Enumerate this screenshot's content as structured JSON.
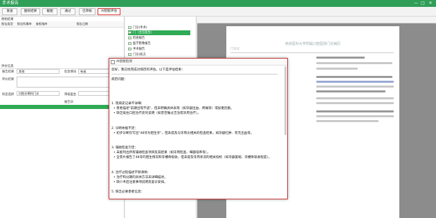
{
  "app": {
    "title": "手术报告",
    "win_min": "—",
    "win_max": "□",
    "win_close": "✕"
  },
  "toolbar": {
    "buttons": [
      "发送",
      "图标结果",
      "截图",
      "通过",
      "已审核",
      "AI智能评估"
    ],
    "active_index": 5
  },
  "left": {
    "section1": "原始结果",
    "grid_headers": [
      "报告类型",
      "报告所属库",
      "查报指库",
      "",
      "报告日期"
    ],
    "section2": "评价信息",
    "row1": {
      "label_a": "报告结果",
      "value_a": "其他",
      "label_b": "危急情况",
      "value_b": "有或"
    },
    "row2": {
      "label_a": "评价结果"
    },
    "row3": {
      "label_a": "科室选择",
      "value_a": "口腔诊断科门诊",
      "label_b": "审核医生"
    },
    "row4": {
      "label_b": "报告日"
    }
  },
  "tree": {
    "items": [
      "门诊(手术)",
      "门（主任医生）",
      "检查报告",
      "医学影像报告",
      "手术报告",
      "门诊(处方"
    ],
    "selected_index": 1
  },
  "document": {
    "title_line": "南京医科大学附属口腔医院门诊病历",
    "subtitle_line": "门诊号"
  },
  "dialog": {
    "title": "AI智能检测",
    "lines": [
      {
        "t": "您好，我已经完成对病历的评估。以下是评估结果：",
        "cls": ""
      },
      {
        "t": "病历问题：",
        "cls": ""
      },
      {
        "t": "1. 现病史记录不详细：",
        "cls": ""
      },
      {
        "t": "• 患者描述\"前期出现不适\"，但未明确具体表现（如牙龈出血、疼痛等）或加重因素。",
        "cls": "sub"
      },
      {
        "t": "• 缺乏既往口腔治疗史的说明（如曾否做过洁治或牙周治疗）。",
        "cls": "sub"
      },
      {
        "t": "2. 诊断依据不足：",
        "cls": ""
      },
      {
        "t": "• 初步诊断仅写出\"48牙为阻生牙\"，但未提及与牙周炎相关的检查结果，如牙龈红肿、有无出血等。",
        "cls": "sub"
      },
      {
        "t": "3. 辅助检查欠佳：",
        "cls": ""
      },
      {
        "t": "• 未能列出所有辅助检查项目及其结果（如牙周检查、细菌培养等）。",
        "cls": "sub"
      },
      {
        "t": "• 全景片报告了48牙的阻生情况和牙槽骨吸收，但未提及牙周状况的相关指标（如牙龈萎缩、牙槽骨吸收程度）。",
        "cls": "sub"
      },
      {
        "t": "4. 治疗过程描述不够清晰：",
        "cls": ""
      },
      {
        "t": "• 治疗和分期的具体方法未详细描述。",
        "cls": "sub"
      },
      {
        "t": "• 缺少术后注意事项说明及复诊安排。",
        "cls": "sub"
      },
      {
        "t": "5. 缺乏必要患者信息：",
        "cls": ""
      }
    ]
  },
  "colors": {
    "brand_green": "#2f9e57",
    "highlight_red": "#d33"
  }
}
